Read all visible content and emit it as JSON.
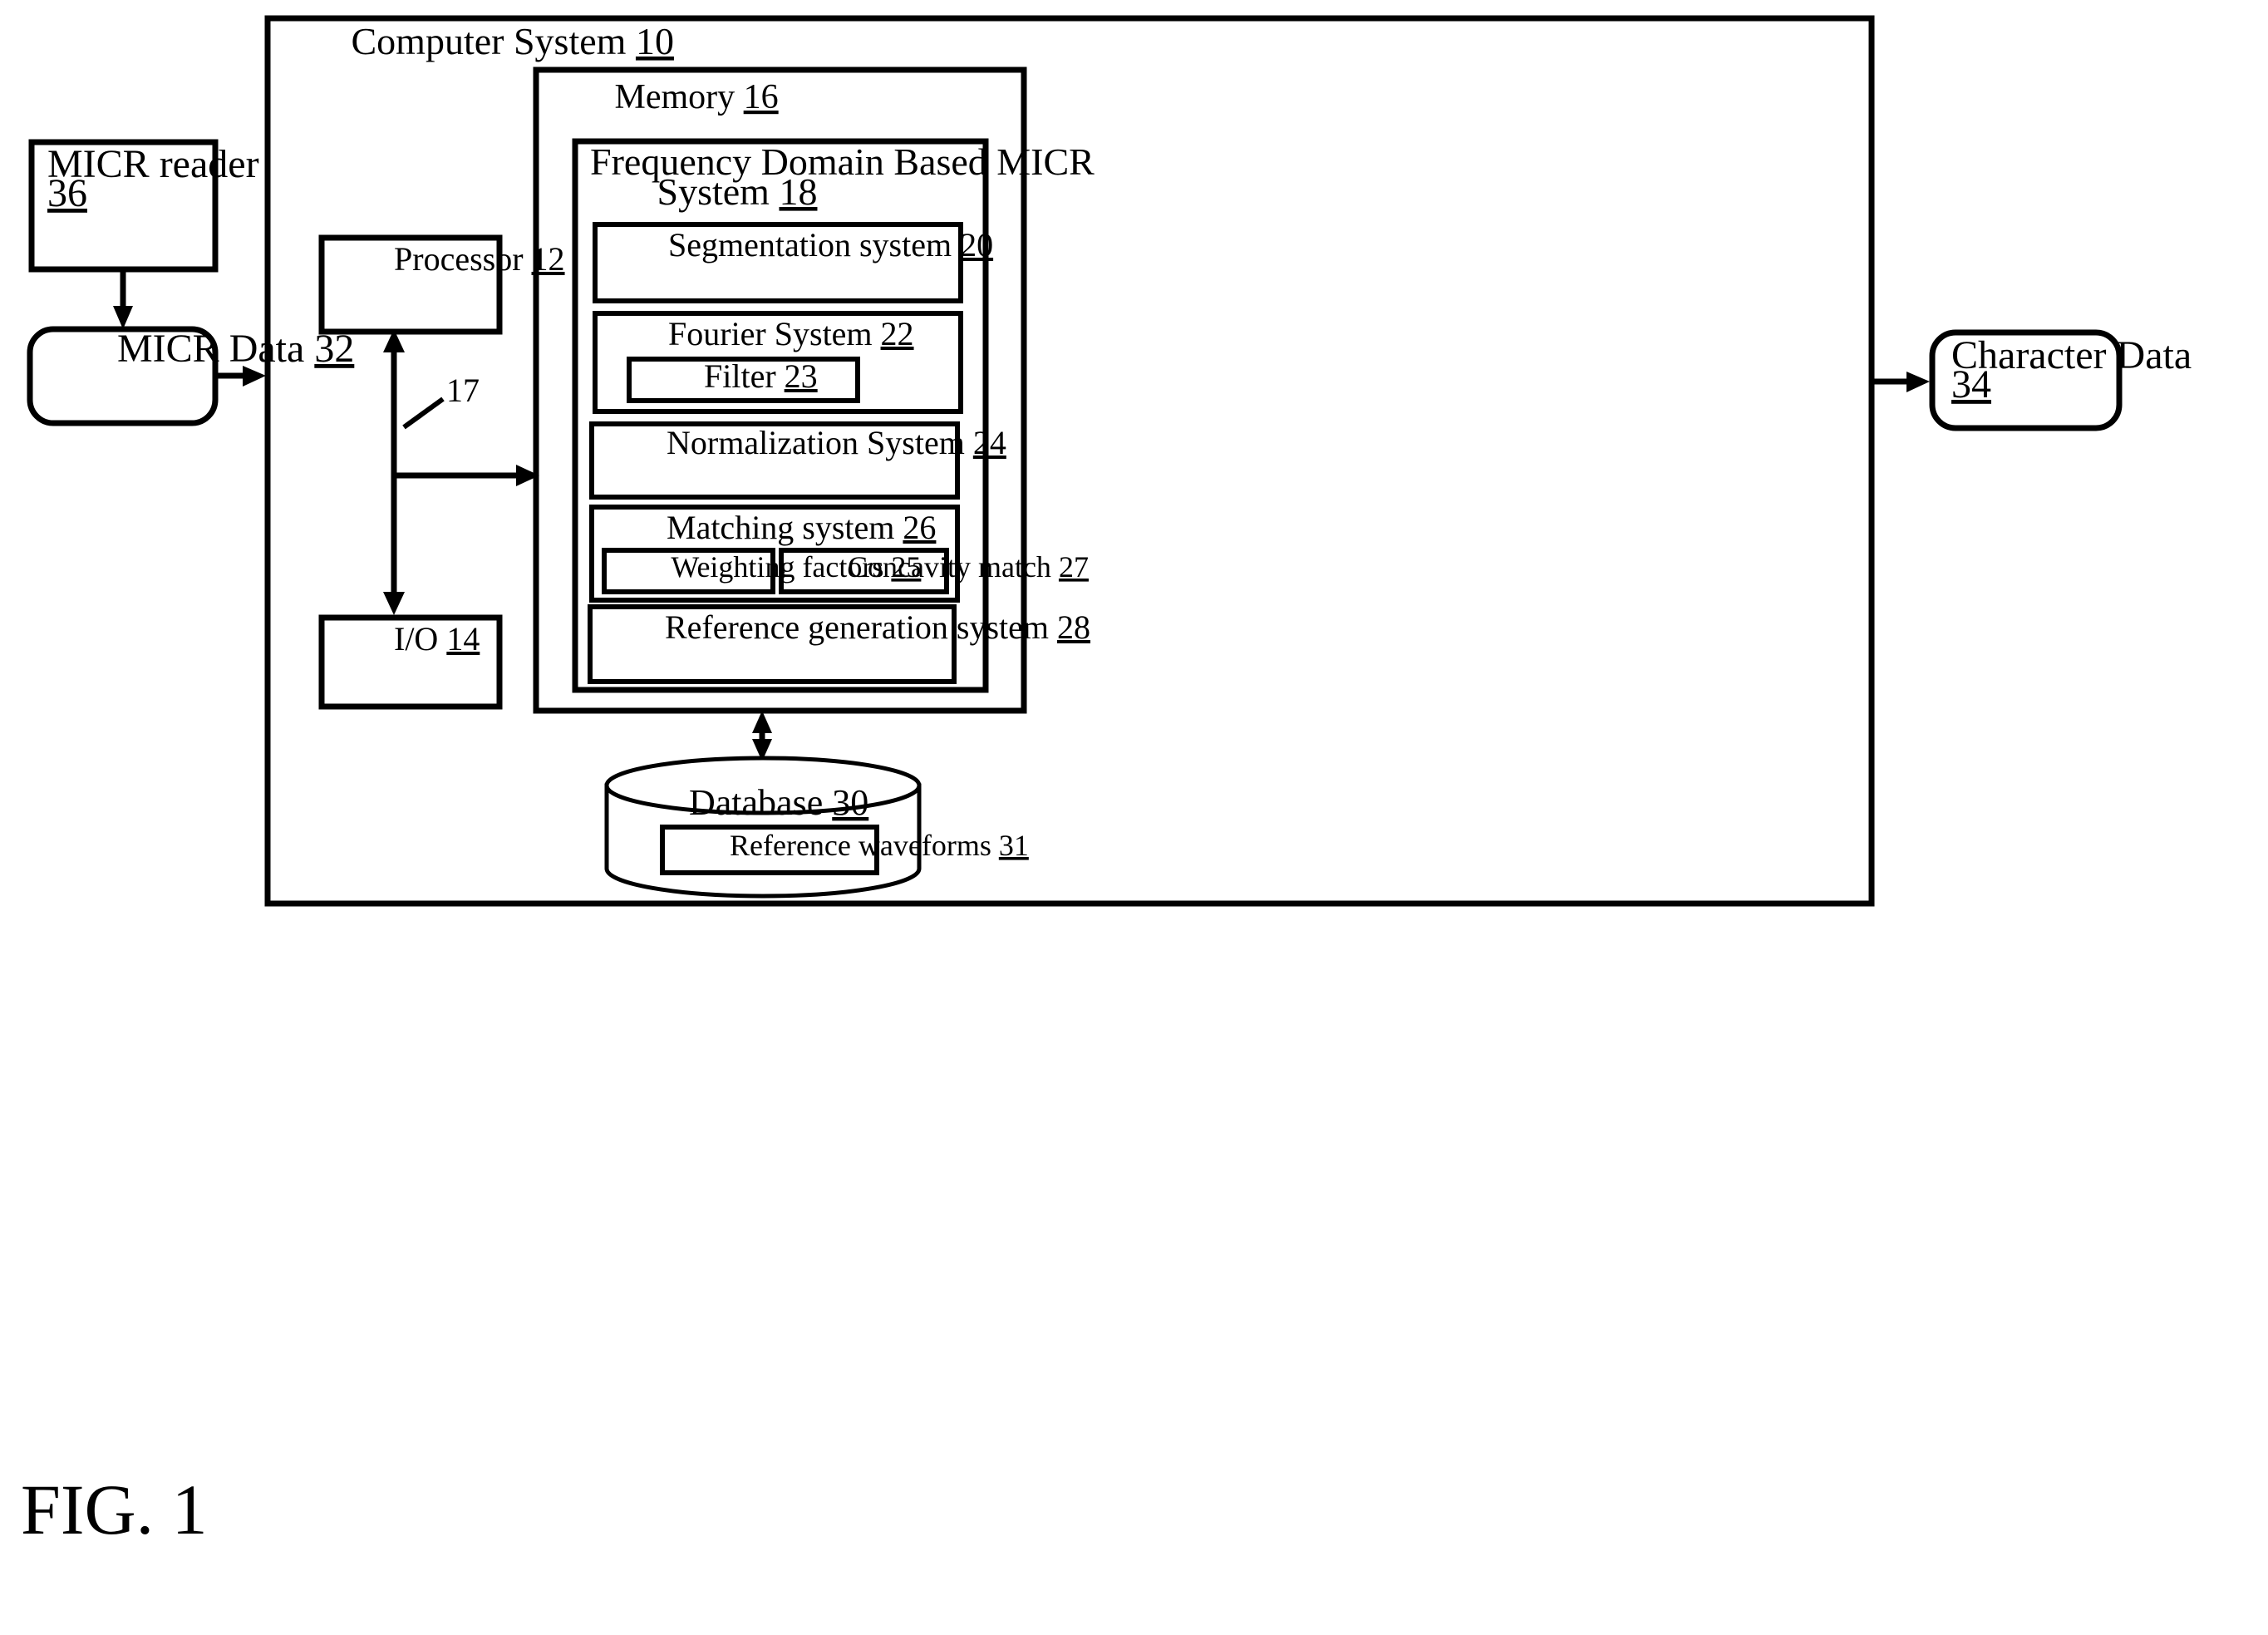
{
  "figure": {
    "label": "FIG. 1"
  },
  "outer": {
    "title_text": "Computer System",
    "title_ref": "10"
  },
  "memory": {
    "title_text": "Memory",
    "title_ref": "16"
  },
  "micr_system": {
    "title_line1": "Frequency Domain Based MICR",
    "title_line2_text": "System",
    "title_line2_ref": "18",
    "modules": [
      {
        "label": "Segmentation system",
        "ref": "20"
      },
      {
        "label": "Fourier System",
        "ref": "22"
      },
      {
        "label": "Normalization System",
        "ref": "24"
      },
      {
        "label": "Matching system",
        "ref": "26"
      },
      {
        "label": "Reference generation system",
        "ref": "28"
      }
    ],
    "filter": {
      "label": "Filter",
      "ref": "23"
    },
    "weighting": {
      "label": "Weighting factors",
      "ref": "25"
    },
    "concavity": {
      "label": "Concavity match",
      "ref": "27"
    }
  },
  "processor": {
    "label": "Processor",
    "ref": "12"
  },
  "io": {
    "label": "I/O",
    "ref": "14"
  },
  "bus": {
    "ref": "17"
  },
  "database": {
    "label": "Database",
    "ref": "30",
    "inner": {
      "label": "Reference waveforms",
      "ref": "31"
    }
  },
  "micr_reader": {
    "line1": "MICR reader",
    "line2_ref": "36"
  },
  "micr_data": {
    "label": "MICR Data",
    "ref": "32"
  },
  "character_data": {
    "line1": "Character Data",
    "line2_ref": "34"
  },
  "colors": {
    "stroke": "#000000",
    "background": "#ffffff",
    "text": "#000000"
  }
}
